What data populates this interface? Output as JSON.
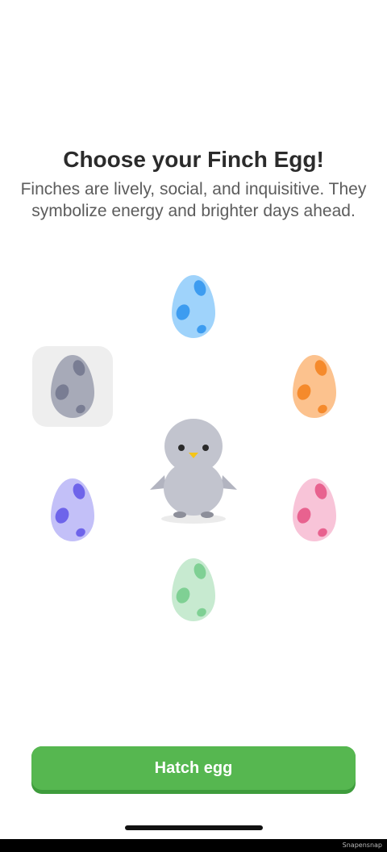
{
  "header": {
    "title": "Choose your Finch Egg!",
    "subtitle": "Finches are lively, social, and inquisitive. They symbolize energy and brighter days ahead."
  },
  "eggs": [
    {
      "name": "blue-egg",
      "shell": "#9fd3fb",
      "spots": "#3d9cf0",
      "selected": false
    },
    {
      "name": "gray-egg",
      "shell": "#a7aab8",
      "spots": "#797d93",
      "selected": true
    },
    {
      "name": "orange-egg",
      "shell": "#fcc28e",
      "spots": "#f58a2c",
      "selected": false
    },
    {
      "name": "purple-egg",
      "shell": "#c3c0f8",
      "spots": "#6e64ea",
      "selected": false
    },
    {
      "name": "pink-egg",
      "shell": "#f8c4d8",
      "spots": "#e8628f",
      "selected": false
    },
    {
      "name": "green-egg",
      "shell": "#c7ead0",
      "spots": "#7fd094",
      "selected": false
    }
  ],
  "finch": {
    "icon": "finch-chick-icon",
    "body_color": "#c2c4ce",
    "beak_color": "#f5c518"
  },
  "actions": {
    "hatch_label": "Hatch egg",
    "accent": "#56b750"
  },
  "watermark": "Snapensnap"
}
